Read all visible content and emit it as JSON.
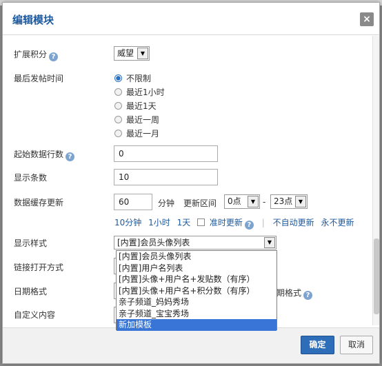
{
  "dialog": {
    "title": "编辑模块",
    "close_glyph": "×"
  },
  "fields": {
    "expand_points": {
      "label": "扩展积分",
      "value": "威望"
    },
    "last_post_time": {
      "label": "最后发帖时间",
      "options": [
        "不限制",
        "最近1小时",
        "最近1天",
        "最近一周",
        "最近一月"
      ],
      "selected": "不限制"
    },
    "start_row": {
      "label": "起始数据行数",
      "value": "0"
    },
    "display_count": {
      "label": "显示条数",
      "value": "10"
    },
    "cache": {
      "label": "数据缓存更新",
      "value": "60",
      "unit": "分钟",
      "range_label": "更新区间",
      "range_start": "0点",
      "range_dash": "-",
      "range_end": "23点",
      "quick_links": [
        "10分钟",
        "1小时",
        "1天"
      ],
      "on_time_label": "准时更新",
      "separator": "|",
      "no_auto": "不自动更新",
      "never": "永不更新"
    },
    "display_style": {
      "label": "显示样式",
      "value": "[内置]会员头像列表",
      "options": [
        "[内置]会员头像列表",
        "[内置]用户名列表",
        "[内置]头像+用户名+发贴数（有序）",
        "[内置]头像+用户名+积分数（有序）",
        "亲子频道_妈妈秀场",
        "亲子频道_宝宝秀场",
        "新加模板"
      ],
      "highlighted": "新加模板"
    },
    "link_open": {
      "label": "链接打开方式"
    },
    "date_format": {
      "label": "日期格式",
      "partial_text": "期格式"
    },
    "custom_content": {
      "label": "自定义内容"
    }
  },
  "footer": {
    "confirm_label": "确定",
    "cancel_label": "取消"
  }
}
